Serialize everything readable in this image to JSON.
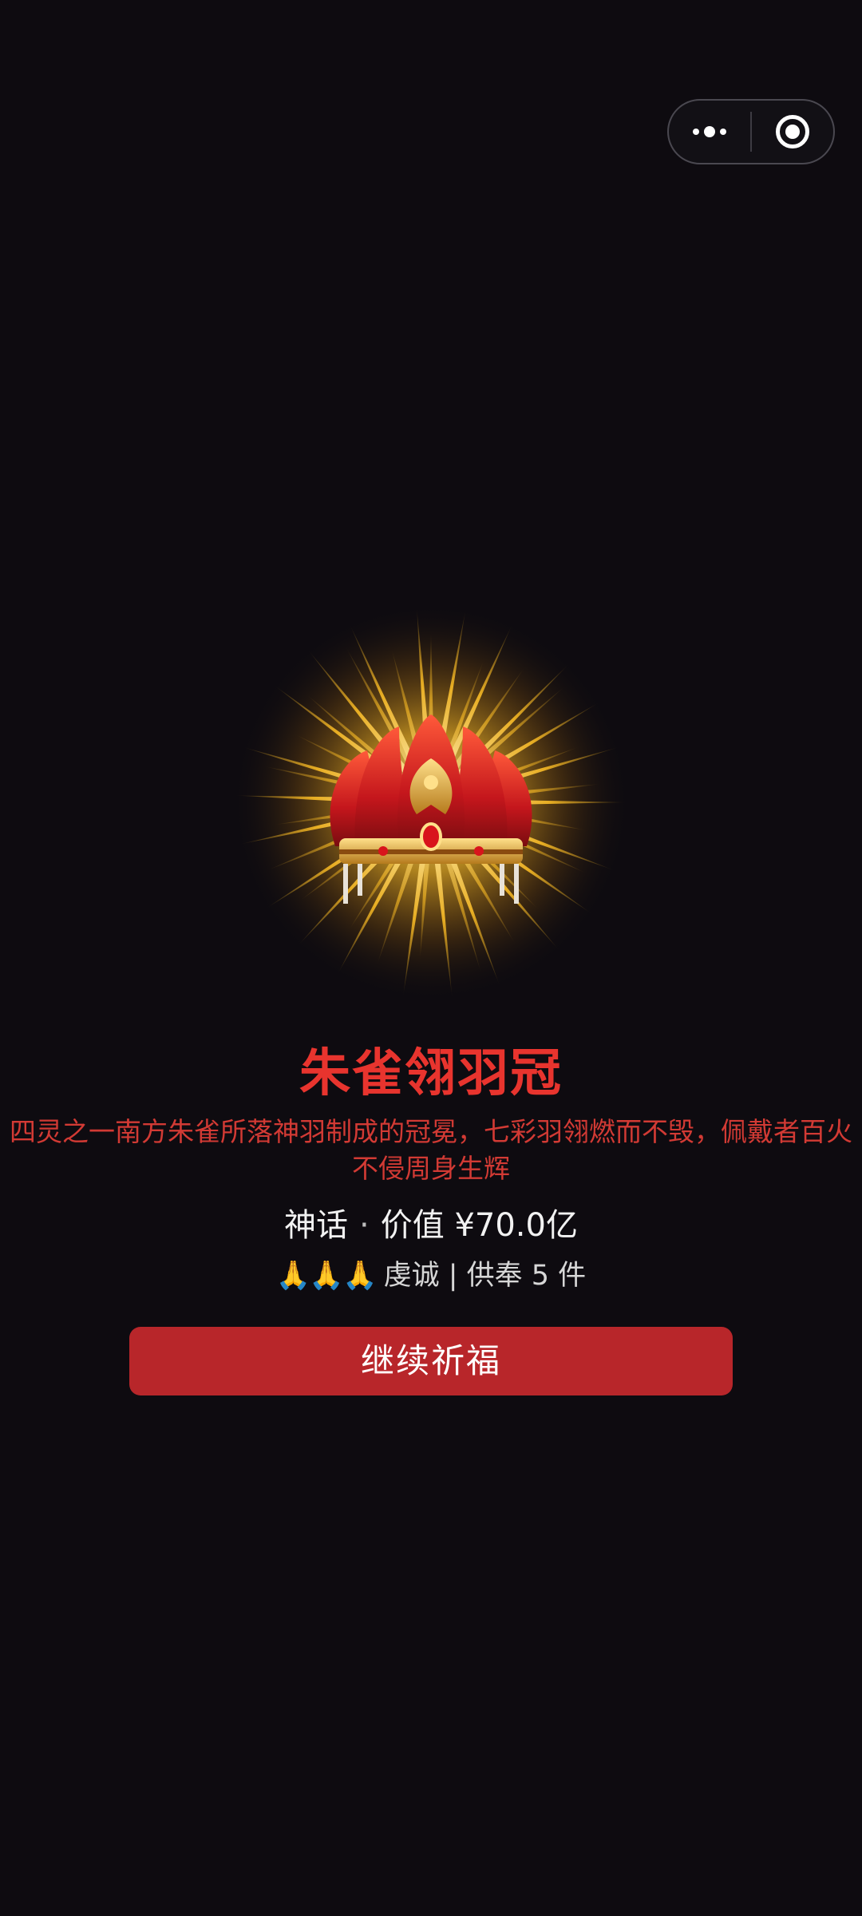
{
  "capsule": {
    "more_icon": "more-dots-icon",
    "close_icon": "target-circle-icon"
  },
  "item": {
    "name": "朱雀翎羽冠",
    "description": "四灵之一南方朱雀所落神羽制成的冠冕，七彩羽翎燃而不毁，佩戴者百火不侵周身生辉",
    "rarity": "神话",
    "separator": "·",
    "value_label": "价值 ¥70.0亿",
    "prayer_hands": "🙏🙏🙏",
    "devotion_text": "虔诚 | 供奉 5 件",
    "image_icon": "phoenix-crown-icon"
  },
  "actions": {
    "continue_label": "继续祈福"
  },
  "colors": {
    "background": "#0e0b10",
    "title": "#e8342e",
    "description": "#d23a34",
    "button": "#b8262a"
  }
}
